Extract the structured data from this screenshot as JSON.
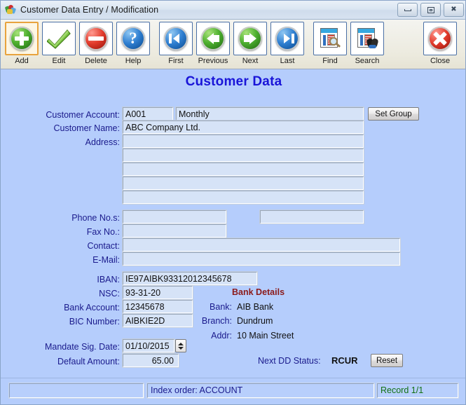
{
  "window": {
    "title": "Customer Data Entry / Modification",
    "app_icon": "app-logo-icon",
    "minimize_label": "Minimize",
    "restore_label": "Restore",
    "close_label": "Close"
  },
  "toolbar": {
    "groups": [
      {
        "name": "record-actions",
        "buttons": [
          {
            "label": "Add",
            "icon": "plus-circle-icon",
            "focused": true
          },
          {
            "label": "Edit",
            "icon": "checkmark-icon",
            "focused": false
          },
          {
            "label": "Delete",
            "icon": "minus-circle-icon",
            "focused": false
          },
          {
            "label": "Help",
            "icon": "question-mark-icon",
            "focused": false
          }
        ]
      },
      {
        "name": "navigation",
        "buttons": [
          {
            "label": "First",
            "icon": "skip-back-icon",
            "focused": false
          },
          {
            "label": "Previous",
            "icon": "arrow-left-icon",
            "focused": false
          },
          {
            "label": "Next",
            "icon": "arrow-right-icon",
            "focused": false
          },
          {
            "label": "Last",
            "icon": "skip-forward-icon",
            "focused": false
          }
        ]
      },
      {
        "name": "lookup",
        "buttons": [
          {
            "label": "Find",
            "icon": "magnifier-document-icon",
            "focused": false
          },
          {
            "label": "Search",
            "icon": "binoculars-document-icon",
            "focused": false
          }
        ]
      },
      {
        "name": "close",
        "buttons": [
          {
            "label": "Close",
            "icon": "x-circle-icon",
            "focused": false
          }
        ]
      }
    ]
  },
  "form": {
    "title": "Customer Data",
    "labels": {
      "customer_account": "Customer Account:",
      "customer_name": "Customer Name:",
      "address": "Address:",
      "phone": "Phone No.s:",
      "fax": "Fax No.:",
      "contact": "Contact:",
      "email": "E-Mail:",
      "iban": "IBAN:",
      "nsc": "NSC:",
      "bank_account": "Bank Account:",
      "bic_number": "BIC Number:",
      "mandate_sig_date": "Mandate Sig. Date:",
      "default_amount": "Default Amount:"
    },
    "values": {
      "customer_account": "A001",
      "customer_group": "Monthly",
      "customer_name": "ABC Company Ltd.",
      "address_1": "",
      "address_2": "",
      "address_3": "",
      "address_4": "",
      "address_5": "",
      "phone_1": "",
      "phone_2": "",
      "fax": "",
      "contact": "",
      "email": "",
      "iban": "IE97AIBK93312012345678",
      "nsc": "93-31-20",
      "bank_account": "12345678",
      "bic_number": "AIBKIE2D",
      "mandate_sig_date": "01/10/2015",
      "default_amount": "65.00"
    },
    "buttons": {
      "set_group": "Set Group",
      "reset": "Reset"
    },
    "bank_details": {
      "heading": "Bank Details",
      "bank_label": "Bank:",
      "bank_value": "AIB Bank",
      "branch_label": "Branch:",
      "branch_value": "Dundrum",
      "addr_label": "Addr:",
      "addr_value": "10 Main Street"
    },
    "dd_status": {
      "label": "Next DD Status:",
      "value": "RCUR"
    }
  },
  "statusbar": {
    "left": "",
    "index_order": "Index order: ACCOUNT",
    "record": "Record 1/1"
  },
  "colors": {
    "form_background": "#b5cdfc",
    "title_text": "#1914d8",
    "label_text": "#1a1a8c",
    "bank_heading": "#8b1a1a",
    "record_text": "#127012",
    "field_background": "#d6e3f7"
  }
}
